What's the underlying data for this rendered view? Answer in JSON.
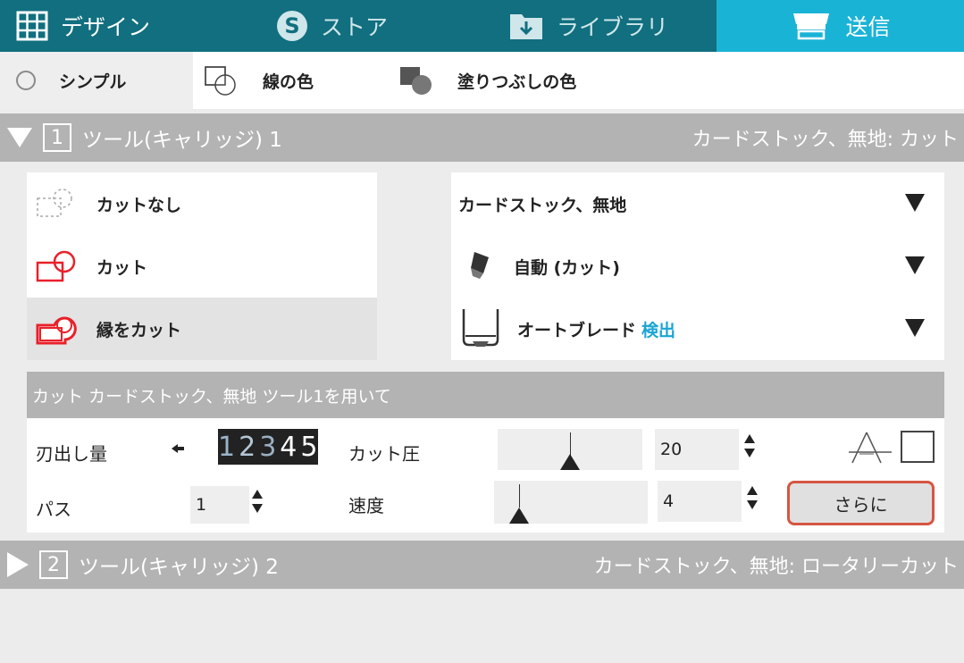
{
  "tabs": [
    {
      "label": "デザイン",
      "icon": "grid-icon"
    },
    {
      "label": "ストア",
      "icon": "store-s-icon"
    },
    {
      "label": "ライブラリ",
      "icon": "library-download-icon"
    },
    {
      "label": "送信",
      "icon": "cutter-send-icon"
    }
  ],
  "subnav": {
    "simple": "シンプル",
    "line_color": "線の色",
    "fill_color": "塗りつぶしの色"
  },
  "tool1": {
    "num": "1",
    "title": "ツール(キャリッジ) 1",
    "summary": "カードストック、無地: カット"
  },
  "cut_modes": [
    {
      "label": "カットなし",
      "icon": "no-cut-icon",
      "selected": false
    },
    {
      "label": "カット",
      "icon": "cut-icon",
      "selected": false
    },
    {
      "label": "縁をカット",
      "icon": "cut-edge-icon",
      "selected": true
    }
  ],
  "dropdowns": {
    "material": "カードストック、無地",
    "action": "自動 (カット)",
    "tool": "オートブレード",
    "tool_detect": "検出"
  },
  "settings": {
    "header": "カット カードストック、無地 ツール1を用いて",
    "blade_depth_label": "刃出し量",
    "blade_depth_digits": [
      "1",
      "2",
      "3",
      "4",
      "5"
    ],
    "passes_label": "パス",
    "passes_value": "1",
    "force_label": "カット圧",
    "force_value": "20",
    "speed_label": "速度",
    "speed_value": "4",
    "more_button": "さらに"
  },
  "tool2": {
    "num": "2",
    "title": "ツール(キャリッジ) 2",
    "summary": "カードストック、無地: ロータリーカット"
  },
  "colors": {
    "tab_bg": "#116f7f",
    "tab_active": "#19b3d6",
    "section_bar": "#b3b3b3",
    "accent_red": "#e8202a",
    "highlight": "#d65642",
    "detect": "#1aa5d4"
  }
}
